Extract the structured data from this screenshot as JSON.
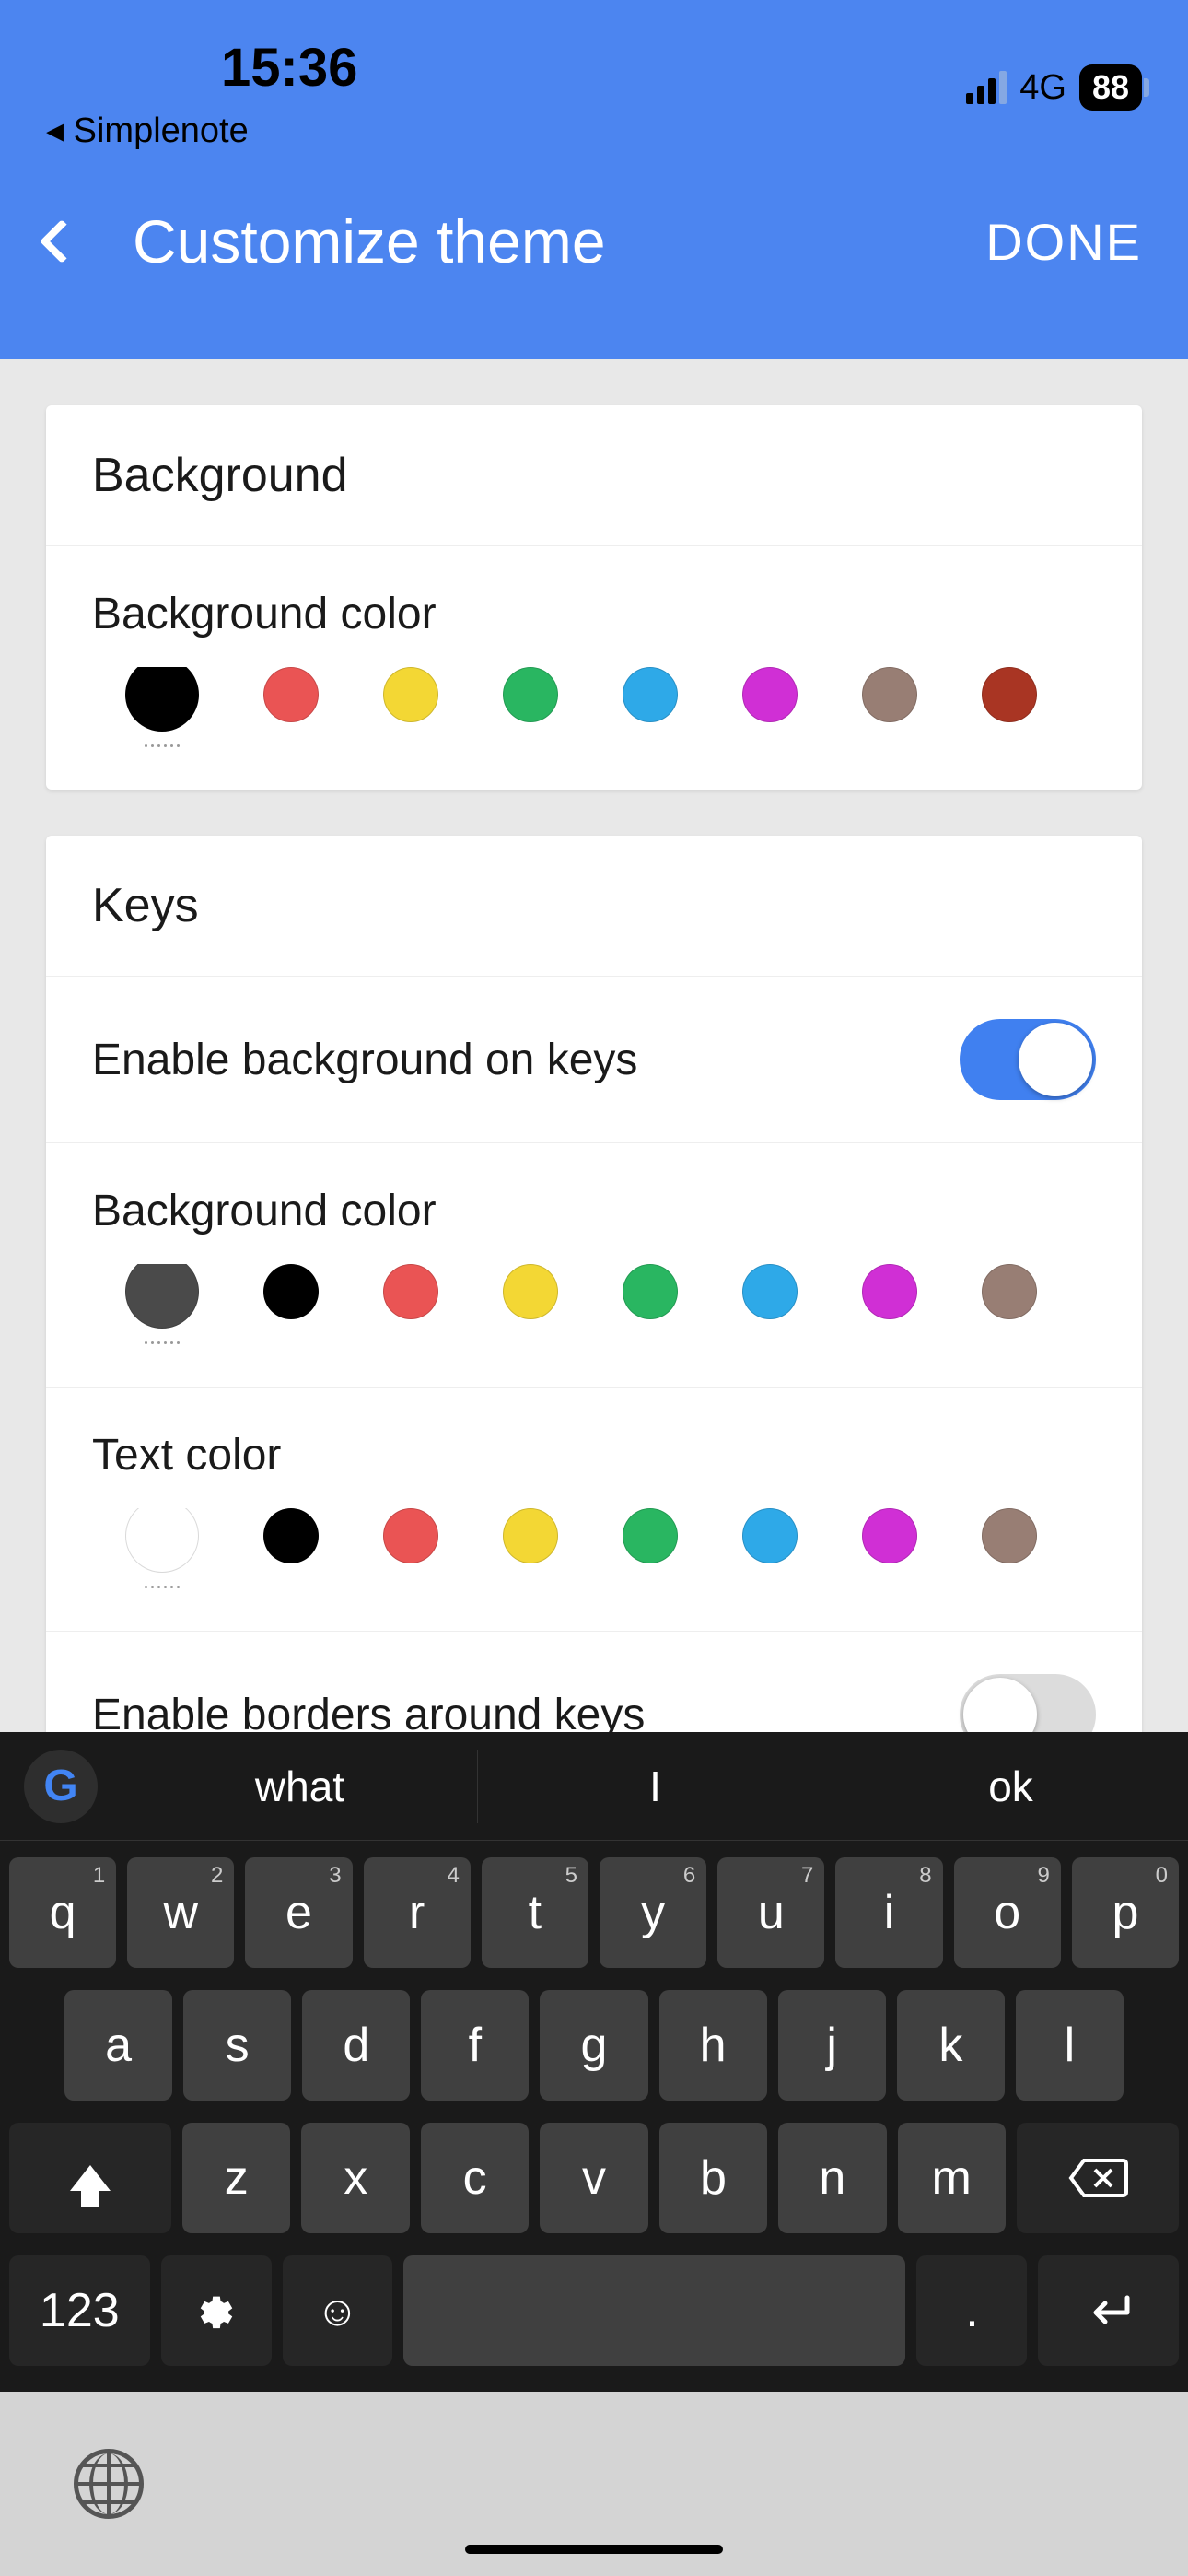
{
  "status": {
    "time": "15:36",
    "back_app": "◂ Simplenote",
    "network": "4G",
    "battery": "88"
  },
  "nav": {
    "title": "Customize theme",
    "done": "DONE"
  },
  "sections": {
    "background": {
      "header": "Background",
      "color_label": "Background color",
      "colors": [
        "#000000",
        "#ea5454",
        "#f3d734",
        "#29b661",
        "#2ea9e8",
        "#d02fd5",
        "#987e74",
        "#a93523",
        "#e68a19",
        "#4c8a28"
      ]
    },
    "keys": {
      "header": "Keys",
      "enable_bg_label": "Enable background on keys",
      "enable_bg_on": true,
      "bg_color_label": "Background color",
      "bg_colors": [
        "#4a4a4a",
        "#000000",
        "#ea5454",
        "#f3d734",
        "#29b661",
        "#2ea9e8",
        "#d02fd5",
        "#987e74",
        "#a93523",
        "#e68a19"
      ],
      "text_color_label": "Text color",
      "text_colors": [
        "#ffffff",
        "#000000",
        "#ea5454",
        "#f3d734",
        "#29b661",
        "#2ea9e8",
        "#d02fd5",
        "#987e74",
        "#a93523",
        "#e68a19"
      ],
      "borders_label": "Enable borders around keys",
      "borders_on": false
    }
  },
  "keyboard": {
    "suggestions": [
      "what",
      "I",
      "ok"
    ],
    "row1": [
      {
        "k": "q",
        "h": "1"
      },
      {
        "k": "w",
        "h": "2"
      },
      {
        "k": "e",
        "h": "3"
      },
      {
        "k": "r",
        "h": "4"
      },
      {
        "k": "t",
        "h": "5"
      },
      {
        "k": "y",
        "h": "6"
      },
      {
        "k": "u",
        "h": "7"
      },
      {
        "k": "i",
        "h": "8"
      },
      {
        "k": "o",
        "h": "9"
      },
      {
        "k": "p",
        "h": "0"
      }
    ],
    "row2": [
      "a",
      "s",
      "d",
      "f",
      "g",
      "h",
      "j",
      "k",
      "l"
    ],
    "row3": [
      "z",
      "x",
      "c",
      "v",
      "b",
      "n",
      "m"
    ],
    "num_key": "123",
    "period": "."
  }
}
